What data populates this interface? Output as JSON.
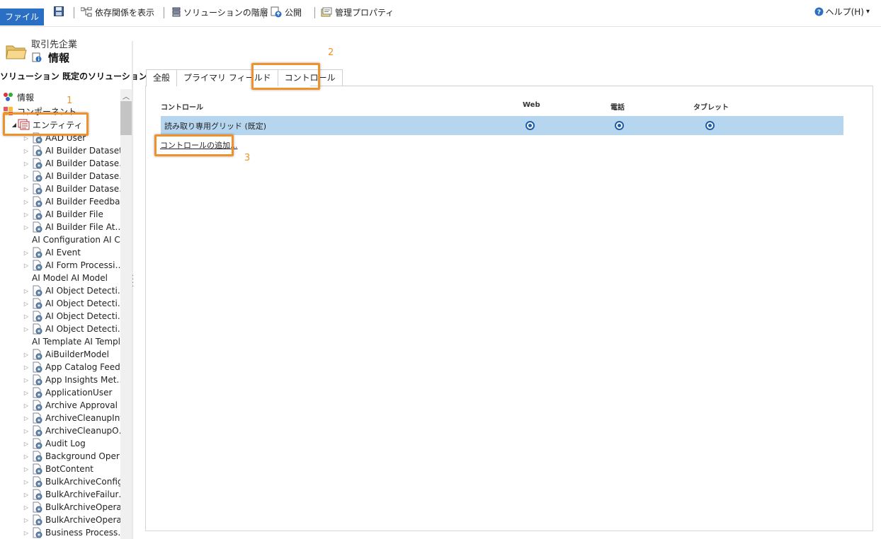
{
  "toolbar": {
    "file_label": "ファイル",
    "show_dependencies": "依存関係を表示",
    "solution_layers": "ソリューションの階層",
    "publish": "公開",
    "managed_properties": "管理プロパティ",
    "help": "ヘルプ(H)",
    "help_arrow": "▾"
  },
  "header": {
    "entity_type": "取引先企業",
    "entity_name": "情報",
    "solution_label": "ソリューション 既定のソリューション"
  },
  "tree": {
    "info_label": "情報",
    "components_label": "コンポーネント",
    "entities_label": "エンティティ",
    "items": [
      "AAD User",
      "AI Builder Dataset",
      "AI Builder Datase…",
      "AI Builder Datase…",
      "AI Builder Datase…",
      "AI Builder Feedba…",
      "AI Builder File",
      "AI Builder File At…",
      "AI Configuration AI C…",
      "AI Event",
      "AI Form Processi…",
      "AI Model AI Model",
      "AI Object Detecti…",
      "AI Object Detecti…",
      "AI Object Detecti…",
      "AI Object Detecti…",
      "AI Template AI Templ…",
      "AiBuilderModel",
      "App Catalog Feed…",
      "App Insights Met…",
      "ApplicationUser",
      "Archive Approval",
      "ArchiveCleanupInfo",
      "ArchiveCleanupO…",
      "Audit Log",
      "Background Oper…",
      "BotContent",
      "BulkArchiveConfig",
      "BulkArchiveFailur…",
      "BulkArchiveOpera…",
      "BulkArchiveOpera…",
      "Business Process…"
    ]
  },
  "tabs": [
    "全般",
    "プライマリ フィールド",
    "コントロール"
  ],
  "controls": {
    "headers": {
      "control": "コントロール",
      "web": "Web",
      "phone": "電話",
      "tablet": "タブレット"
    },
    "rows": [
      {
        "label": "読み取り専用グリッド (既定)"
      }
    ],
    "add_link": "コントロールの追加..."
  },
  "callouts": [
    "1",
    "2",
    "3"
  ],
  "colors": {
    "accent": "#2a6fc3",
    "callout": "#f0922b",
    "selected_row": "#b6d6f0",
    "radio": "#1f5fa8"
  }
}
